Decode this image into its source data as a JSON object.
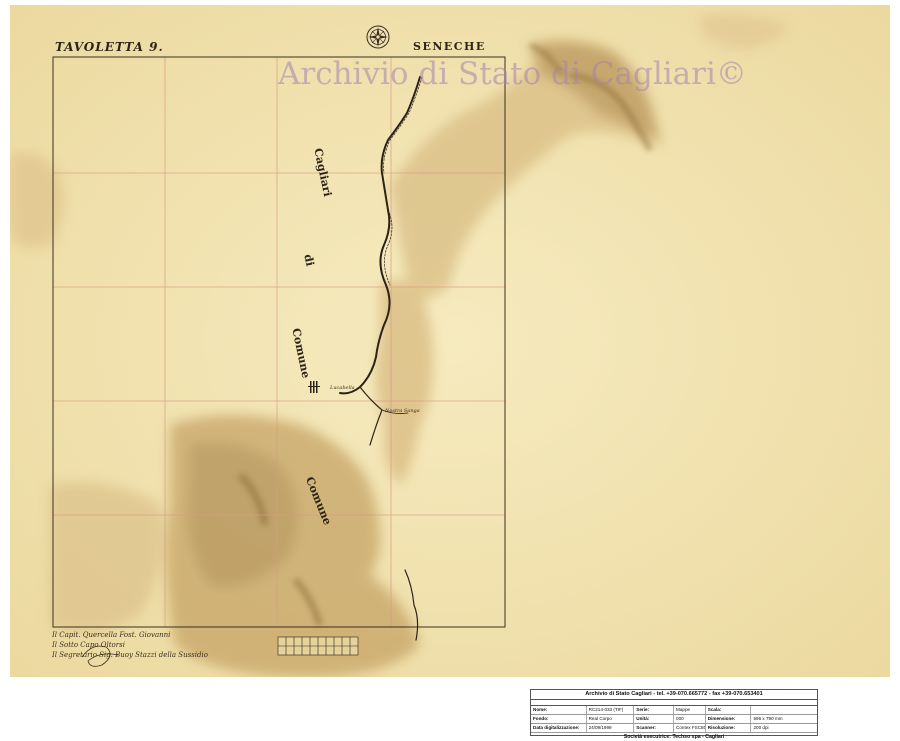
{
  "map": {
    "sheet_title": "TAVOLETTA 9.",
    "title": "SENECHE",
    "watermark": "Archivio di Stato di Cagliari©",
    "labels": {
      "commune_cagliari_1": "Cagliari",
      "commune_cagliari_2": "di",
      "commune_cagliari_3": "Comune",
      "commune_lower": "Comune",
      "place_1": "Lucabella",
      "place_2": "Nostra Sanga"
    },
    "signatures": [
      "Il Capit. Quercella Fost. Giovanni",
      "Il Sotto Capo Oltorsi",
      "Il Segretario Sig. Buoy Stazzi della Sussidio"
    ]
  },
  "info_table": {
    "header": "Archivio di Stato Cagliari - tel. +39-070.665772 - fax +39-070.653401",
    "rows": [
      {
        "k1": "Nome:",
        "v1": "RC214-033 (TIF)",
        "k2": "Serie:",
        "v2": "Mappe",
        "k3": "Scala:",
        "v3": ""
      },
      {
        "k1": "Fondo:",
        "v1": "Real Corpo",
        "k2": "Unità:",
        "v2": "000",
        "k3": "Dimensione:",
        "v3": "596 x 790 mm"
      },
      {
        "k1": "Data digitalizzazione:",
        "v1": "24/09/1999",
        "k2": "Scanner:",
        "v2": "Contex FSC8040",
        "k3": "Risoluzione:",
        "v3": "200 dpi"
      }
    ],
    "footer": "Società esecutrice: Techso spa - Cagliari"
  },
  "colors": {
    "paper": "#f4e6b4",
    "stain": "#c9a86a",
    "grid": "#d89a86",
    "ink": "#2a2418",
    "watermark": "#a582af"
  }
}
